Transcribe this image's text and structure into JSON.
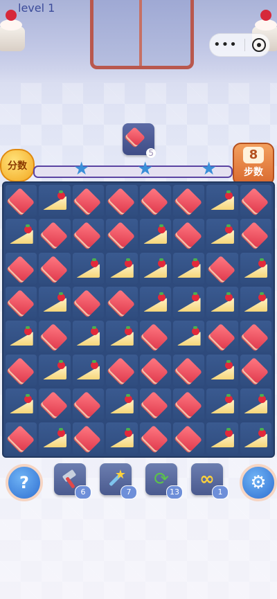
{
  "header": {
    "level_label": "level 1",
    "menu_dots": "•••"
  },
  "goal": {
    "item": "square-cake",
    "remaining": "5"
  },
  "progress": {
    "score_label": "分数",
    "fill_fraction": 0.0,
    "stars": 3
  },
  "moves": {
    "count": "8",
    "label": "步数"
  },
  "board": {
    "rows": 8,
    "cols": 8,
    "grid": [
      [
        "S",
        "T",
        "S",
        "S",
        "S",
        "S",
        "T",
        "S"
      ],
      [
        "T",
        "S",
        "S",
        "S",
        "T",
        "S",
        "T",
        "S"
      ],
      [
        "S",
        "S",
        "T",
        "T",
        "T",
        "T",
        "S",
        "T"
      ],
      [
        "S",
        "T",
        "S",
        "S",
        "T",
        "T",
        "T",
        "T"
      ],
      [
        "T",
        "S",
        "T",
        "T",
        "S",
        "T",
        "S",
        "S"
      ],
      [
        "S",
        "T",
        "T",
        "S",
        "S",
        "S",
        "T",
        "S"
      ],
      [
        "T",
        "S",
        "S",
        "T",
        "S",
        "S",
        "T",
        "T"
      ],
      [
        "S",
        "T",
        "S",
        "T",
        "S",
        "S",
        "T",
        "T"
      ]
    ]
  },
  "toolbar": {
    "help_label": "?",
    "tools": [
      {
        "name": "hammer",
        "count": "6"
      },
      {
        "name": "magic-wand",
        "count": "7"
      },
      {
        "name": "shuffle",
        "count": "13"
      },
      {
        "name": "infinite-moves",
        "count": "1"
      }
    ]
  },
  "colors": {
    "board": "#2e4a7c",
    "square_cake": "#e03a4d",
    "triangle_cake": "#f6d67a",
    "track": "#5a43a2",
    "star": "#3a8fd8",
    "moves_badge": "#d9692e"
  }
}
